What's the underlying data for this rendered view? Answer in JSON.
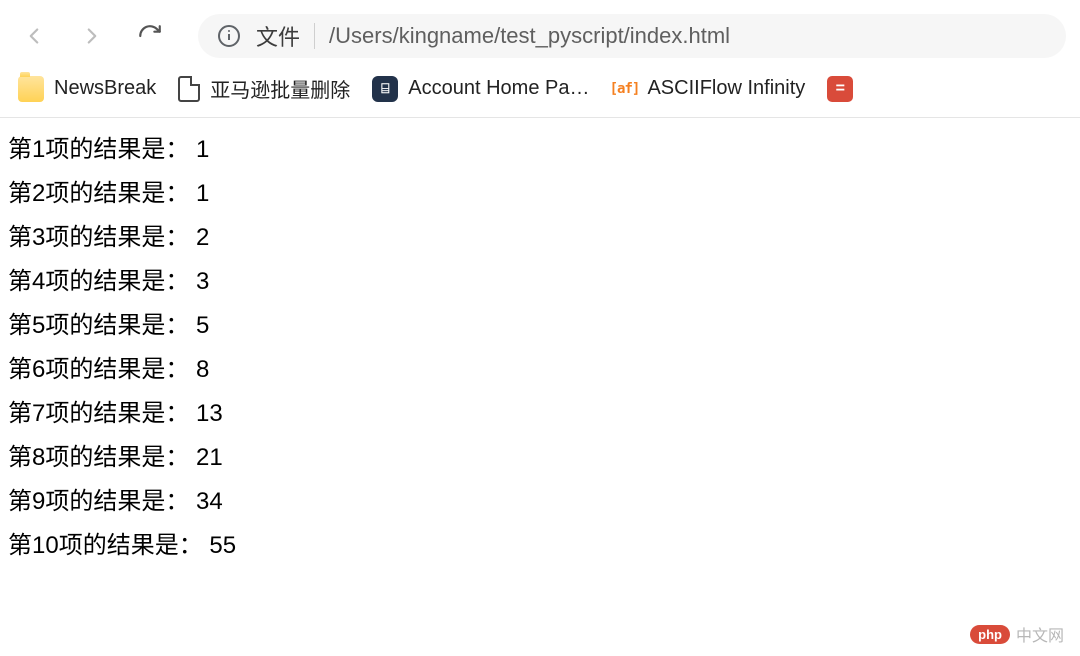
{
  "address": {
    "file_label": "文件",
    "path": "/Users/kingname/test_pyscript/index.html"
  },
  "bookmarks": [
    {
      "label": "NewsBreak",
      "iconClass": "folder",
      "iconText": ""
    },
    {
      "label": "亚马逊批量删除",
      "iconClass": "file",
      "iconText": ""
    },
    {
      "label": "Account Home Pa…",
      "iconClass": "db",
      "iconText": "⌸"
    },
    {
      "label": "ASCIIFlow Infinity",
      "iconClass": "af",
      "iconText": "[af]"
    },
    {
      "label": "",
      "iconClass": "red",
      "iconText": "="
    }
  ],
  "results": [
    {
      "index": 1,
      "value": 1
    },
    {
      "index": 2,
      "value": 1
    },
    {
      "index": 3,
      "value": 2
    },
    {
      "index": 4,
      "value": 3
    },
    {
      "index": 5,
      "value": 5
    },
    {
      "index": 6,
      "value": 8
    },
    {
      "index": 7,
      "value": 13
    },
    {
      "index": 8,
      "value": 21
    },
    {
      "index": 9,
      "value": 34
    },
    {
      "index": 10,
      "value": 55
    }
  ],
  "line_template": "第{i}项的结果是： {v}",
  "watermark": {
    "badge": "php",
    "text": "中文网"
  }
}
